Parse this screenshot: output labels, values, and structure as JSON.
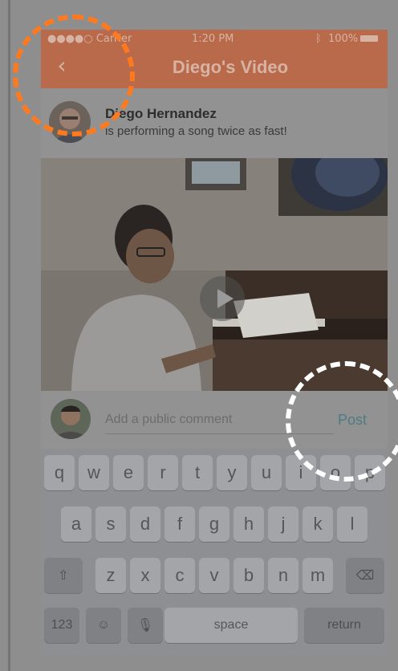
{
  "status_bar": {
    "carrier": "●●●●○ Carrier",
    "time": "1:20 PM",
    "battery": "100%"
  },
  "nav": {
    "back_glyph": "‹",
    "title": "Diego's Video"
  },
  "post": {
    "author_name": "Diego Hernandez",
    "status_text": "is performing a song twice as fast!"
  },
  "video": {
    "play_icon": "play-icon"
  },
  "comment": {
    "placeholder": "Add a public comment",
    "post_label": "Post"
  },
  "keyboard": {
    "row1": [
      "q",
      "w",
      "e",
      "r",
      "t",
      "y",
      "u",
      "i",
      "o",
      "p"
    ],
    "row2": [
      "a",
      "s",
      "d",
      "f",
      "g",
      "h",
      "j",
      "k",
      "l"
    ],
    "row3": [
      "z",
      "x",
      "c",
      "v",
      "b",
      "n",
      "m"
    ],
    "numbers_label": "123",
    "space_label": "space",
    "return_label": "return",
    "shift_glyph": "⇧",
    "delete_glyph": "⌫",
    "emoji_glyph": "☺",
    "mic_glyph": "🎙"
  },
  "colors": {
    "navbar": "#b86a4a",
    "annotation_orange": "#ff7a1f",
    "annotation_white": "#ffffff",
    "post_text": "#4e7b83"
  }
}
